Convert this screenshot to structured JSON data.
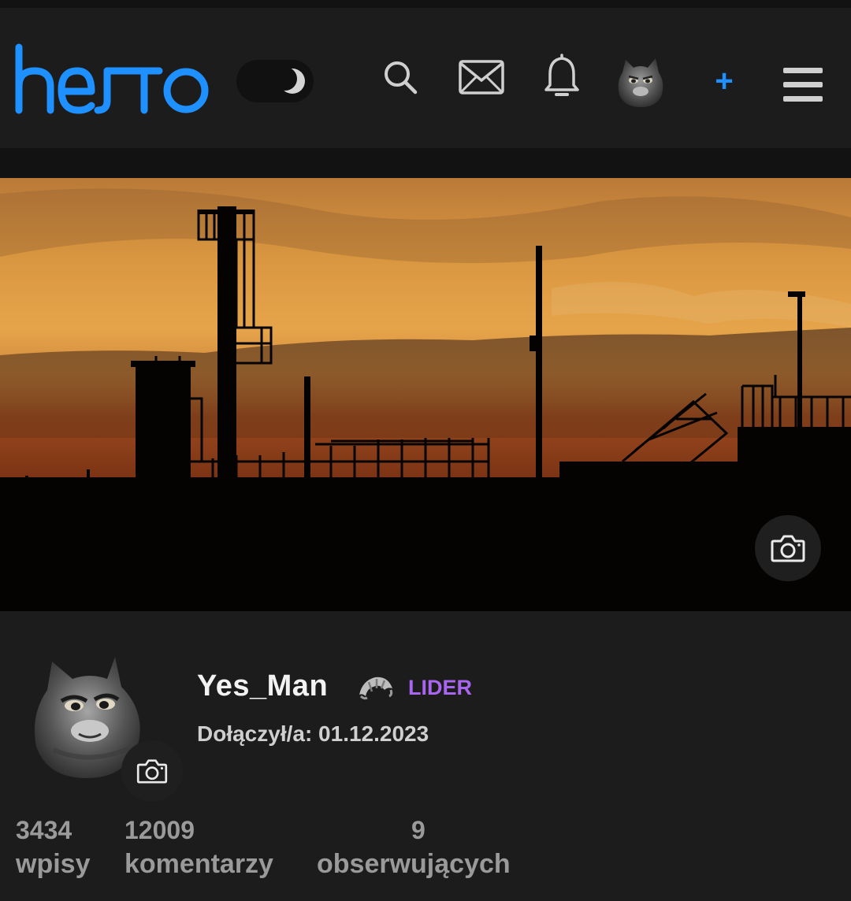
{
  "header": {
    "logo_text": "hejto",
    "accent_color": "#1e90ff",
    "icons": [
      "theme-toggle-moon-icon",
      "search-icon",
      "mail-icon",
      "bell-icon",
      "user-avatar",
      "plus-icon",
      "hamburger-menu-icon"
    ],
    "plus_label": "+"
  },
  "banner": {
    "camera_icon": "camera-icon"
  },
  "profile": {
    "username": "Yes_Man",
    "badge_icon": "croissant-icon",
    "rank": "LIDER",
    "rank_color": "#a866ee",
    "joined": "Dołączył/a: 01.12.2023"
  },
  "stats": [
    {
      "value": "3434",
      "label": "wpisy"
    },
    {
      "value": "12009",
      "label": "komentarzy"
    },
    {
      "value": "9",
      "label": "obserwujących"
    }
  ]
}
